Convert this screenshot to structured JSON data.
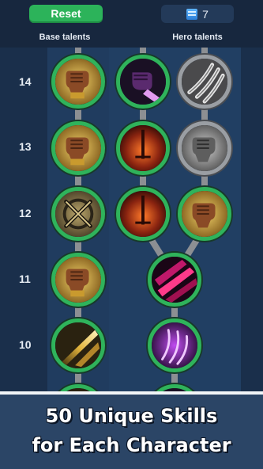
{
  "toolbar": {
    "reset_label": "Reset",
    "points_value": "7",
    "points_icon": "book-icon"
  },
  "headers": {
    "base": "Base talents",
    "hero": "Hero talents"
  },
  "levels": [
    "14",
    "13",
    "12",
    "11",
    "10"
  ],
  "banner": {
    "line1": "50 Unique Skills",
    "line2": "for Each Character"
  },
  "colors": {
    "unlocked_ring": "#2fb35b",
    "locked_ring": "#9a9ea3",
    "reset_button": "#2cb35a"
  },
  "talents": {
    "base": [
      "gauntlet-fist-icon",
      "gauntlet-fist-icon",
      "crossed-swords-icon",
      "gauntlet-fist-icon",
      "golden-slash-icon"
    ],
    "hero": [
      "purple-fist-icon",
      "claw-slash-icon",
      "flaming-sword-icon",
      "silver-gauntlet-icon",
      "flaming-sword-icon",
      "gold-gauntlet-icon",
      "crimson-slash-icon",
      "violet-claw-icon"
    ]
  }
}
